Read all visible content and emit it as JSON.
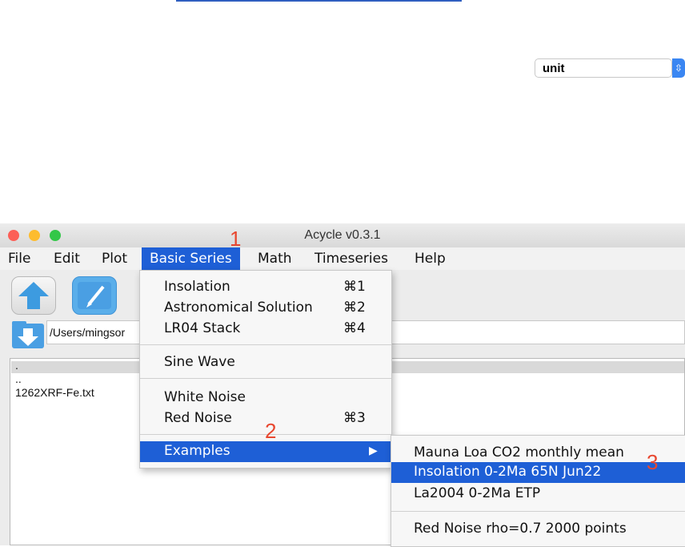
{
  "window": {
    "title": "Acycle v0.3.1"
  },
  "menubar": {
    "items": [
      "File",
      "Edit",
      "Plot",
      "Basic Series",
      "Math",
      "Timeseries",
      "Help"
    ]
  },
  "toolbar": {
    "unit_select": "unit"
  },
  "path": {
    "value": "/Users/mingsor"
  },
  "filelist": {
    "rows": [
      ".",
      "..",
      "1262XRF-Fe.txt"
    ]
  },
  "dropdown": {
    "items": [
      {
        "label": "Insolation",
        "shortcut": "⌘1"
      },
      {
        "label": "Astronomical Solution",
        "shortcut": "⌘2"
      },
      {
        "label": "LR04 Stack",
        "shortcut": "⌘4"
      },
      {
        "label": "Sine Wave",
        "shortcut": ""
      },
      {
        "label": "White Noise",
        "shortcut": ""
      },
      {
        "label": "Red Noise",
        "shortcut": "⌘3"
      },
      {
        "label": "Examples",
        "shortcut": "▶"
      }
    ]
  },
  "submenu": {
    "items": [
      "Mauna Loa CO2 monthly mean",
      "Insolation 0-2Ma 65N Jun22",
      "La2004 0-2Ma ETP",
      "Red Noise rho=0.7 2000 points"
    ]
  },
  "annotations": {
    "step1": "1",
    "step2": "2",
    "step3": "3"
  },
  "colors": {
    "accent": "#1e5fd6",
    "annotation": "#e8472f"
  },
  "icons": [
    "upload-arrow-icon",
    "folder-edit-icon",
    "folder-down-arrow-icon",
    "chevron-updown-icon"
  ]
}
